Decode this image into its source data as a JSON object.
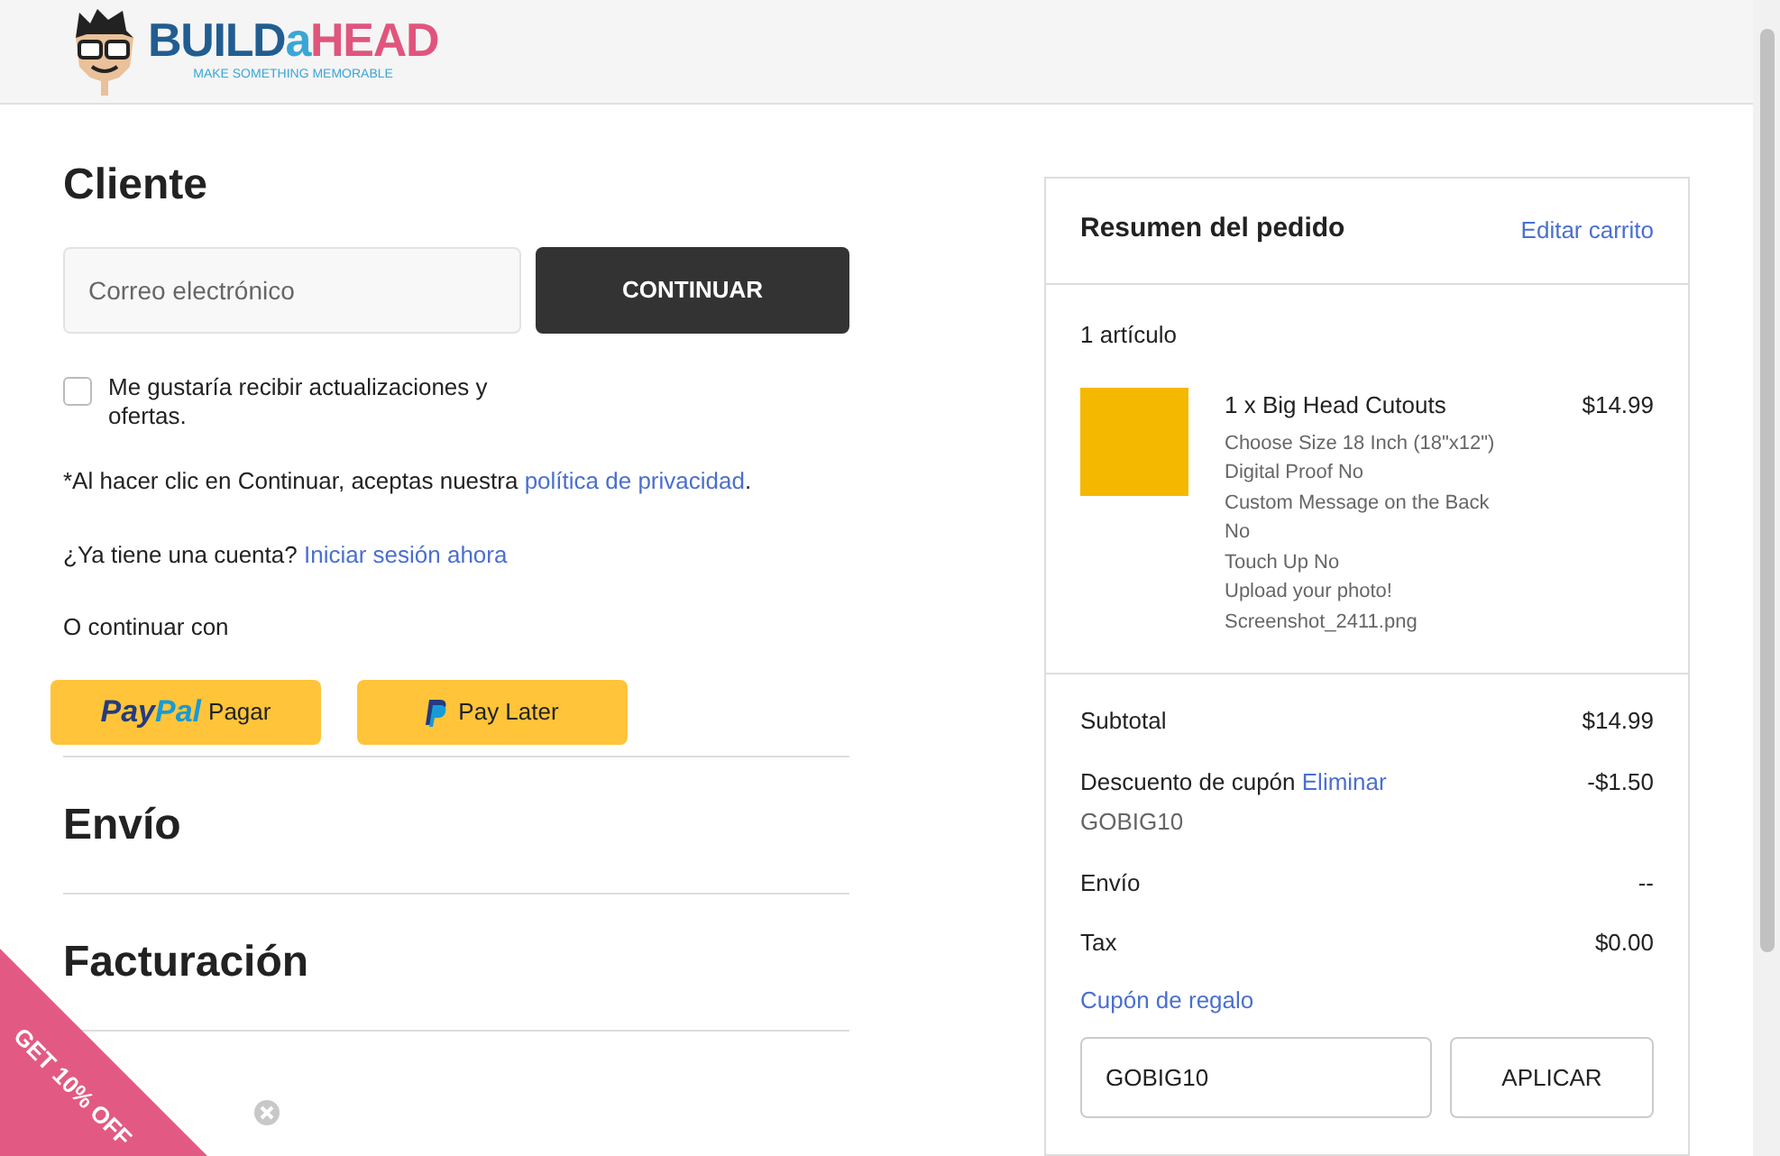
{
  "logo": {
    "parts": [
      "BUILD",
      "a",
      "HEAD"
    ],
    "tagline": "MAKE SOMETHING MEMORABLE"
  },
  "customer": {
    "title": "Cliente",
    "email": {
      "placeholder": "Correo electrónico"
    },
    "continue_button": "CONTINUAR",
    "newsletter": {
      "label": "Me gustaría recibir actualizaciones y ofertas.",
      "checked": false
    },
    "privacy_text": "*Al hacer clic en Continuar, aceptas nuestra",
    "privacy_link": "política de privacidad",
    "privacy_end": ".",
    "account_text": "¿Ya tiene una cuenta?",
    "login_link": "Iniciar sesión ahora",
    "alt_text": "O continuar con",
    "paypal_button": {
      "brand": "PayPal",
      "label": "Pagar"
    },
    "paylater_button": {
      "label": "Pay Later"
    }
  },
  "sections": [
    "Envío",
    "Facturación"
  ],
  "promo": {
    "ribbon": "GET 10% OFF"
  },
  "summary": {
    "title": "Resumen del pedido",
    "edit_link": "Editar carrito",
    "count": "1 artículo",
    "item": {
      "name": "1 x Big Head Cutouts",
      "price": "$14.99",
      "options": [
        "Choose Size 18 Inch (18\"x12\")",
        "Digital Proof No",
        "Custom Message on the Back No",
        "Touch Up No",
        "Upload your photo! Screenshot_2411.png"
      ]
    },
    "totals": [
      {
        "label": "Subtotal",
        "value": "$14.99"
      },
      {
        "label": "Descuento de cupón",
        "link": "Eliminar",
        "code": "GOBIG10",
        "value": "-$1.50"
      },
      {
        "label": "Envío",
        "value": "--"
      },
      {
        "label": "Tax",
        "value": "$0.00"
      }
    ],
    "gift_link": "Cupón de regalo",
    "coupon_value": "GOBIG10",
    "apply_button": "APLICAR"
  }
}
